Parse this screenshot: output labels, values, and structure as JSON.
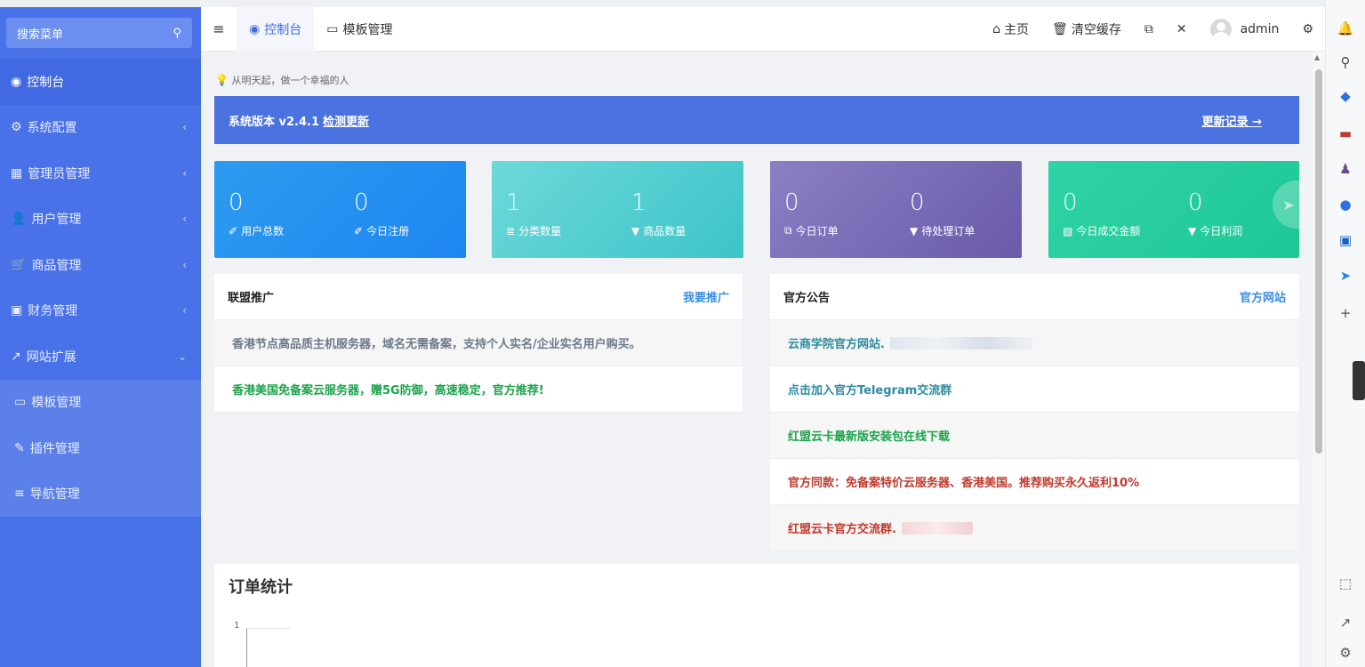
{
  "sidebar": {
    "search_placeholder": "搜索菜单",
    "items": [
      {
        "icon": "dashboard-icon",
        "glyph": "◉",
        "label": "控制台",
        "active": true,
        "chevron": ""
      },
      {
        "icon": "gears-icon",
        "glyph": "⚙",
        "label": "系统配置",
        "chevron": "‹"
      },
      {
        "icon": "windows-icon",
        "glyph": "▦",
        "label": "管理员管理",
        "chevron": "‹"
      },
      {
        "icon": "user-icon",
        "glyph": "👤",
        "label": "用户管理",
        "chevron": "‹"
      },
      {
        "icon": "cart-icon",
        "glyph": "🛒",
        "label": "商品管理",
        "chevron": "‹"
      },
      {
        "icon": "finance-icon",
        "glyph": "▣",
        "label": "财务管理",
        "chevron": "‹"
      },
      {
        "icon": "external-link-icon",
        "glyph": "↗",
        "label": "网站扩展",
        "chevron": "⌄"
      }
    ],
    "subitems": [
      {
        "icon": "monitor-icon",
        "glyph": "▭",
        "label": "模板管理"
      },
      {
        "icon": "plug-icon",
        "glyph": "✎",
        "label": "插件管理"
      },
      {
        "icon": "sliders-icon",
        "glyph": "≡",
        "label": "导航管理"
      }
    ]
  },
  "header": {
    "tabs": [
      {
        "icon": "dashboard-icon",
        "glyph": "◉",
        "label": "控制台",
        "active": true
      },
      {
        "icon": "monitor-icon",
        "glyph": "▭",
        "label": "模板管理"
      }
    ],
    "home": "主页",
    "clear_cache": "清空缓存",
    "user": "admin"
  },
  "main": {
    "tip": "从明天起，做一个幸福的人",
    "version_label": "系统版本 v2.4.1",
    "check_update": "检测更新",
    "changelog": "更新记录 →",
    "stats": [
      [
        {
          "value": "0",
          "label": "用户总数",
          "glyph": "✐"
        },
        {
          "value": "0",
          "label": "今日注册",
          "glyph": "✐"
        }
      ],
      [
        {
          "value": "1",
          "label": "分类数量",
          "glyph": "≣"
        },
        {
          "value": "1",
          "label": "商品数量",
          "glyph": "▼"
        }
      ],
      [
        {
          "value": "0",
          "label": "今日订单",
          "glyph": "⧉"
        },
        {
          "value": "0",
          "label": "待处理订单",
          "glyph": "▼"
        }
      ],
      [
        {
          "value": "0",
          "label": "今日成交金额",
          "glyph": "▨"
        },
        {
          "value": "0",
          "label": "今日利润",
          "glyph": "▼"
        }
      ]
    ],
    "promo": {
      "title": "联盟推广",
      "link": "我要推广",
      "rows": [
        {
          "text": "香港节点高品质主机服务器，域名无需备案，支持个人实名/企业实名用户购买。",
          "color": "#6b7a89"
        },
        {
          "text": "香港美国免备案云服务器，赠5G防御，高速稳定，官方推荐!",
          "color": "#1aa34a"
        }
      ]
    },
    "notice": {
      "title": "官方公告",
      "link": "官方网站",
      "rows": [
        {
          "text": "云商学院官方网站.",
          "color": "#2e8aa0",
          "blur": "plain"
        },
        {
          "text": "点击加入官方Telegram交流群",
          "color": "#2e8aa0"
        },
        {
          "text": "红盟云卡最新版安装包在线下载",
          "color": "#1aa34a"
        },
        {
          "text": "官方同款：免备案特价云服务器、香港美国。推荐购买永久返利10%",
          "color": "#c0392b"
        },
        {
          "text": "红盟云卡官方交流群.",
          "color": "#c0392b",
          "blur": "pink"
        }
      ]
    },
    "orders": {
      "title": "订单统计",
      "y_tick": "1"
    }
  },
  "colors": {
    "sidebar": "#4a72e8",
    "accent": "#3a6ee8"
  }
}
